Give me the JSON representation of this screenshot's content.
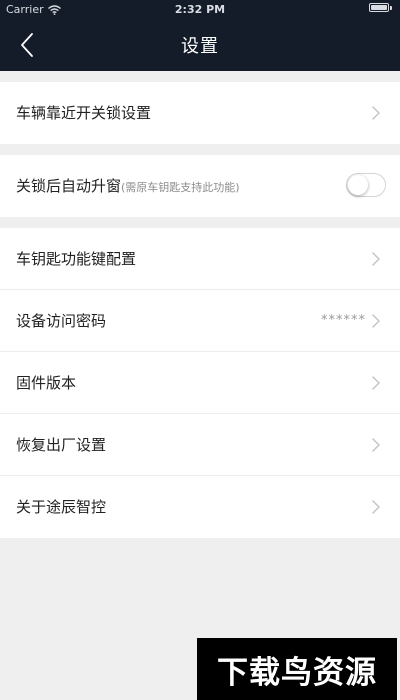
{
  "status_bar": {
    "carrier": "Carrier",
    "time": "2:32 PM",
    "wifi_icon": "wifi-icon",
    "battery_icon": "battery-icon",
    "battery_level": 1.0
  },
  "nav": {
    "title": "设置",
    "back_icon": "chevron-left-icon"
  },
  "sections": [
    {
      "rows": [
        {
          "label": "车辆靠近开关锁设置",
          "accessory": "chevron"
        }
      ]
    },
    {
      "rows": [
        {
          "label": "关锁后自动升窗",
          "note": "(需原车钥匙支持此功能)",
          "accessory": "toggle",
          "toggle_on": false
        }
      ]
    },
    {
      "rows": [
        {
          "label": "车钥匙功能键配置",
          "accessory": "chevron"
        },
        {
          "label": "设备访问密码",
          "value": "******",
          "accessory": "chevron"
        },
        {
          "label": "固件版本",
          "accessory": "chevron"
        },
        {
          "label": "恢复出厂设置",
          "accessory": "chevron"
        },
        {
          "label": "关于途辰智控",
          "accessory": "chevron"
        }
      ]
    }
  ],
  "watermark": {
    "text": "下载鸟资源"
  },
  "colors": {
    "header_bg": "#141c29",
    "page_bg": "#efefef",
    "row_bg": "#ffffff",
    "text_primary": "#222222",
    "text_secondary": "#9a9a9a"
  }
}
